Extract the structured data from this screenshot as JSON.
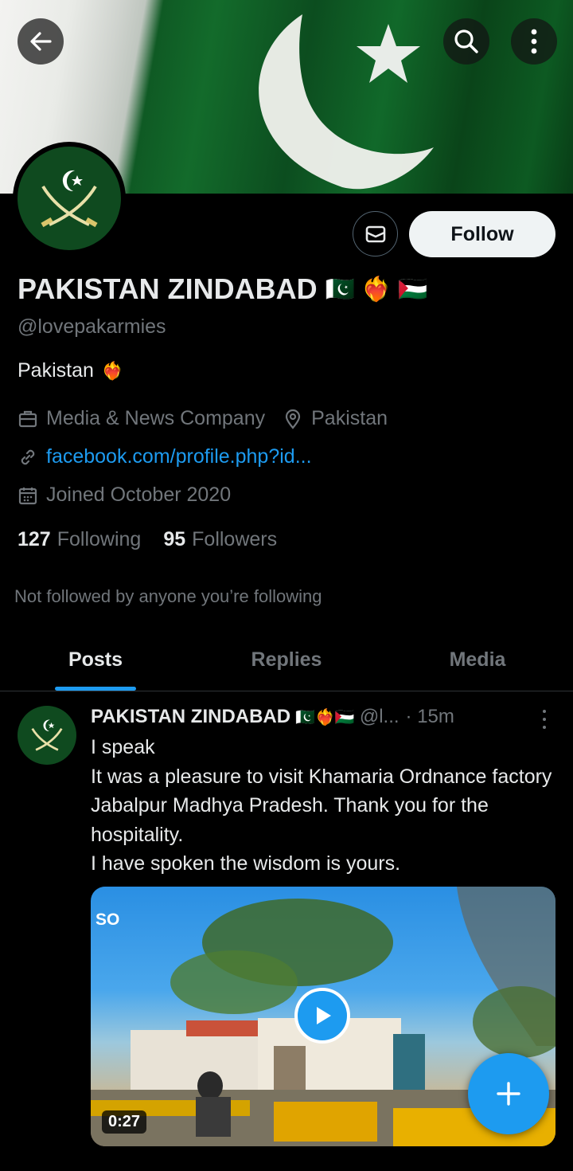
{
  "header": {
    "back_icon": "arrow-left-icon",
    "search_icon": "search-icon",
    "more_icon": "more-vertical-icon"
  },
  "profile": {
    "display_name": "PAKISTAN ZINDABAD",
    "display_name_emojis": "🇵🇰 ❤️‍🔥 🇵🇸",
    "handle": "@lovepakarmies",
    "bio": "Pakistan",
    "bio_emoji": "❤️‍🔥",
    "category": "Media & News Company",
    "location": "Pakistan",
    "link": "facebook.com/profile.php?id...",
    "joined": "Joined October 2020",
    "following_count": "127",
    "following_label": "Following",
    "followers_count": "95",
    "followers_label": "Followers",
    "not_followed_note": "Not followed by anyone you’re following",
    "follow_label": "Follow"
  },
  "tabs": [
    {
      "label": "Posts",
      "active": true
    },
    {
      "label": "Replies",
      "active": false
    },
    {
      "label": "Media",
      "active": false
    }
  ],
  "post": {
    "author_name": "PAKISTAN ZINDABAD",
    "author_emojis": "🇵🇰❤️‍🔥🇵🇸",
    "author_handle": "@l...",
    "time": "· 15m",
    "text": "I speak\nIt was a pleasure to visit Khamaria Ordnance factory Jabalpur Madhya Pradesh. Thank you for the hospitality.\nI have spoken the wisdom is yours.",
    "media_watermark": "SO",
    "video_duration": "0:27"
  },
  "colors": {
    "accent": "#1d9bf0",
    "background": "#000000",
    "muted_text": "#71767b"
  }
}
